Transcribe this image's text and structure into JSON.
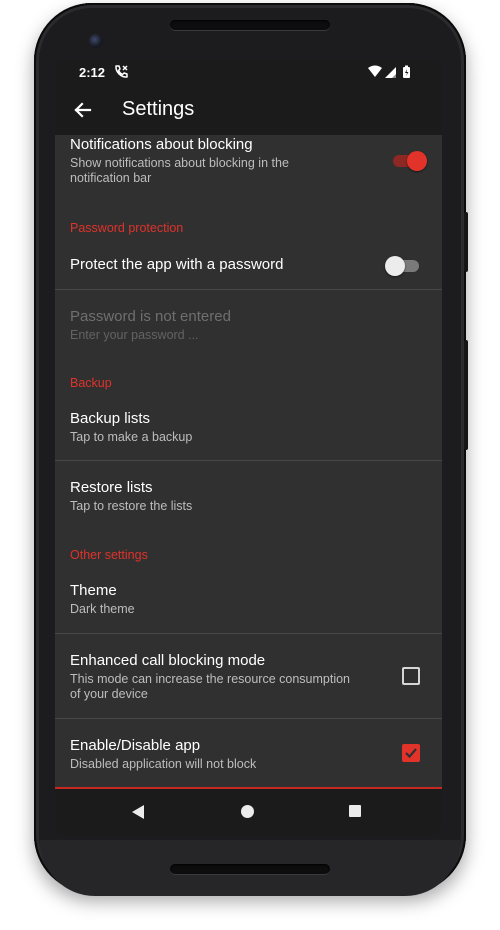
{
  "status_bar": {
    "time": "2:12"
  },
  "app_bar": {
    "title": "Settings",
    "back_icon": "arrow-left-icon"
  },
  "settings": {
    "notifications": {
      "title": "Notifications about blocking",
      "subtitle_line1": "Show notifications about blocking in the",
      "subtitle_line2": "notification bar",
      "enabled": true
    },
    "password_header": "Password protection",
    "protect_password": {
      "title": "Protect the app with a password",
      "enabled": false
    },
    "password_entry": {
      "title": "Password is not entered",
      "subtitle": "Enter your password ...",
      "disabled": true
    },
    "backup_header": "Backup",
    "backup_lists": {
      "title": "Backup lists",
      "subtitle": "Tap to make a backup"
    },
    "restore_lists": {
      "title": "Restore lists",
      "subtitle": "Tap to restore the lists"
    },
    "other_header": "Other settings",
    "theme": {
      "title": "Theme",
      "subtitle": "Dark theme"
    },
    "enhanced_mode": {
      "title": "Enhanced call blocking mode",
      "subtitle_line1": "This mode can increase the resource consumption",
      "subtitle_line2": "of your device",
      "checked": false
    },
    "enable_app": {
      "title": "Enable/Disable app",
      "subtitle": "Disabled application will not block",
      "checked": true
    }
  },
  "colors": {
    "accent": "#e2332b",
    "background": "#303030",
    "toolbar": "#1b1b1b"
  },
  "nav_bar": {
    "back_icon": "triangle-back-icon",
    "home_icon": "circle-home-icon",
    "recents_icon": "square-recents-icon"
  }
}
